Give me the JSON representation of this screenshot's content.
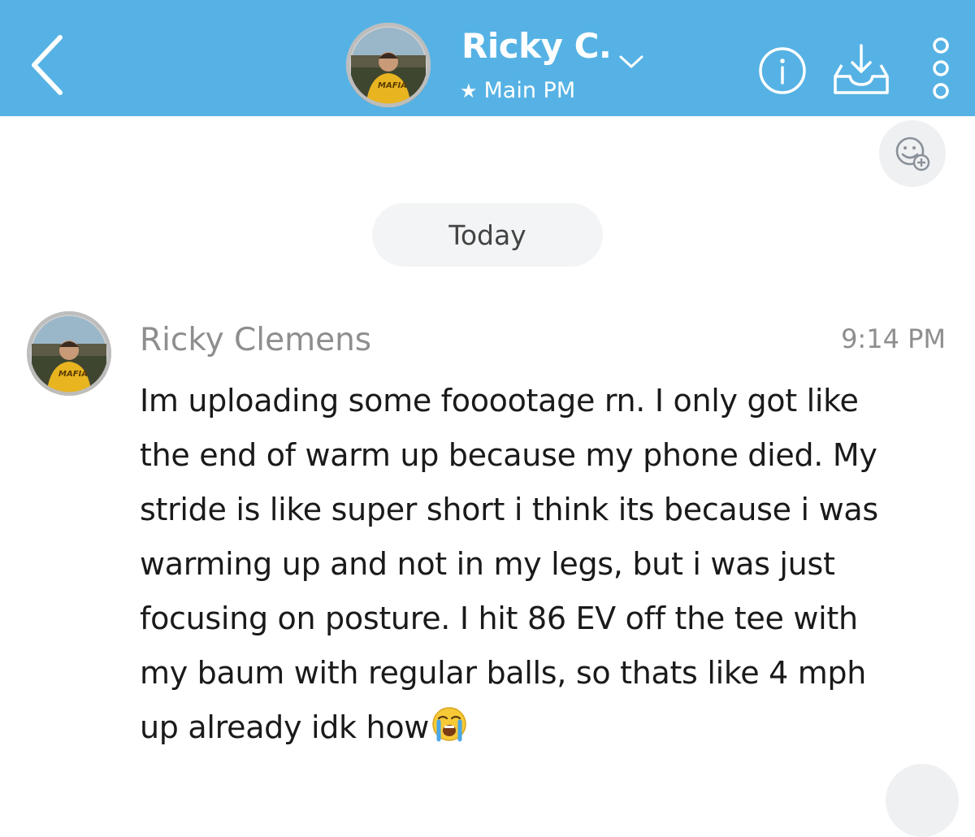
{
  "header": {
    "contact_name": "Ricky C.",
    "subtitle": "Main PM",
    "background_color": "#56b2e4",
    "icons": {
      "back": "back-arrow-icon",
      "chevron": "chevron-down-icon",
      "star": "star-icon",
      "info": "info-icon",
      "save": "save-inbox-icon",
      "more": "more-vertical-icon",
      "friendmoji": "add-friendmoji-icon"
    }
  },
  "chat": {
    "date_divider": "Today",
    "messages": [
      {
        "sender": "Ricky Clemens",
        "time": "9:14 PM",
        "lines": [
          "Im uploading some fooootage rn. I only got like",
          "the end of warm up because my phone died. My",
          "stride is like super short i think its because i was",
          "warming up and not in my legs, but i was just",
          "focusing on posture. I hit 86 EV off the tee with",
          "my baum with regular balls, so thats like 4 mph",
          "up already idk how"
        ],
        "trailing_emoji": "loudly-crying-face-icon"
      }
    ]
  }
}
